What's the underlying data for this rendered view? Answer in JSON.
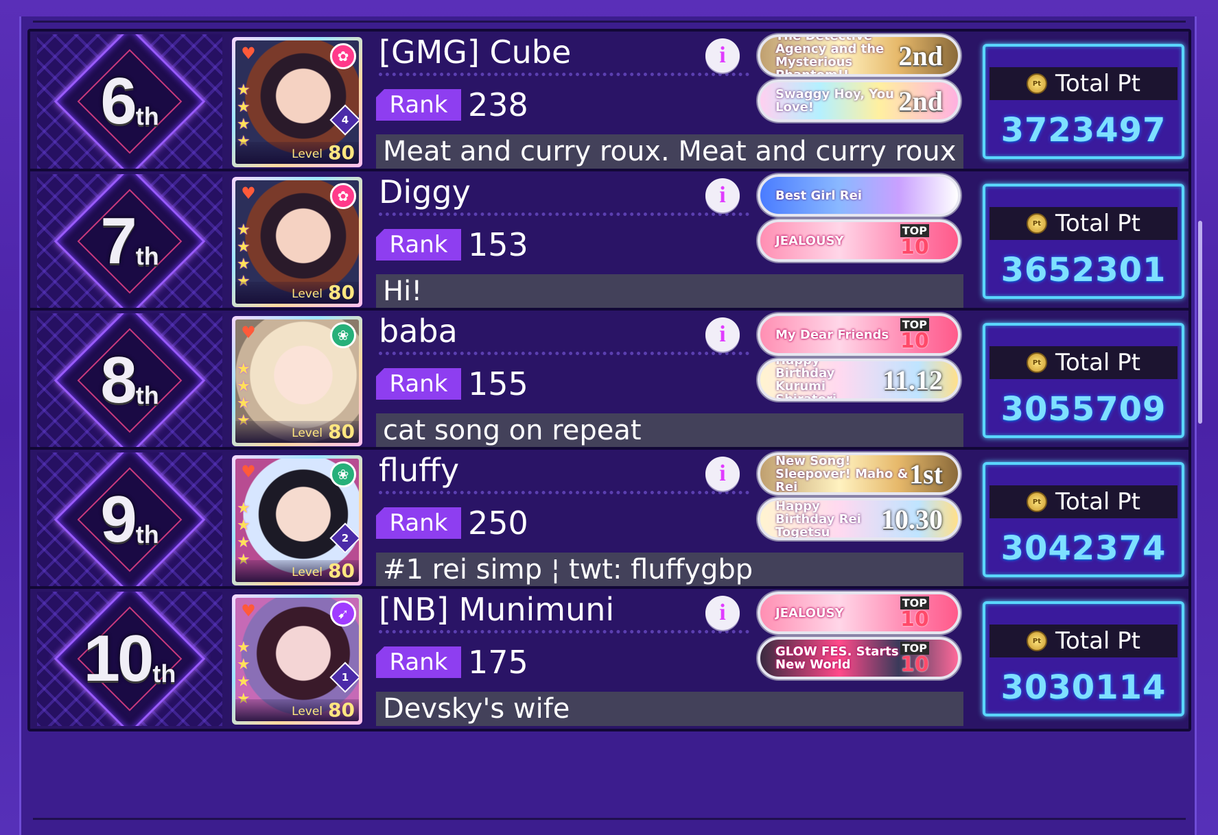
{
  "rows": [
    {
      "place_num": "6",
      "place_suffix": "th",
      "name": "[GMG] Cube",
      "rank_label": "Rank",
      "rank_value": "238",
      "comment": "Meat and curry roux. Meat and curry roux",
      "level_label": "Level",
      "level_value": "80",
      "train_level": "4",
      "titles": [
        {
          "text": "The Detective Agency and the Mysterious Phantom!!",
          "rank": "2nd",
          "style": "gold"
        },
        {
          "text": "Swaggy Hoy, You Love!",
          "rank": "2nd",
          "style": "rainbow"
        }
      ],
      "pts_label": "Total Pt",
      "pts_value": "3723497"
    },
    {
      "place_num": "7",
      "place_suffix": "th",
      "name": "Diggy",
      "rank_label": "Rank",
      "rank_value": "153",
      "comment": "Hi!",
      "level_label": "Level",
      "level_value": "80",
      "train_level": "",
      "titles": [
        {
          "text": "Best Girl Rei",
          "rank": "",
          "style": "blue"
        },
        {
          "text": "JEALOUSY",
          "top_label": "TOP",
          "top_value": "10",
          "style": "pink"
        }
      ],
      "pts_label": "Total Pt",
      "pts_value": "3652301"
    },
    {
      "place_num": "8",
      "place_suffix": "th",
      "name": "baba",
      "rank_label": "Rank",
      "rank_value": "155",
      "comment": "cat song on repeat",
      "level_label": "Level",
      "level_value": "80",
      "train_level": "",
      "titles": [
        {
          "text": "My Dear Friends",
          "top_label": "TOP",
          "top_value": "10",
          "style": "pink"
        },
        {
          "text": "Happy Birthday Kurumi Shiratori",
          "rank": "11.12",
          "style": "birthday"
        }
      ],
      "pts_label": "Total Pt",
      "pts_value": "3055709"
    },
    {
      "place_num": "9",
      "place_suffix": "th",
      "name": "fluffy",
      "rank_label": "Rank",
      "rank_value": "250",
      "comment": "#1 rei simp ¦ twt: fluffygbp",
      "level_label": "Level",
      "level_value": "80",
      "train_level": "2",
      "titles": [
        {
          "text": "New Song! Sleepover! Maho & Rei",
          "rank": "1st",
          "style": "gold"
        },
        {
          "text": "Happy Birthday Rei Togetsu",
          "rank": "10.30",
          "style": "birthday"
        }
      ],
      "pts_label": "Total Pt",
      "pts_value": "3042374"
    },
    {
      "place_num": "10",
      "place_suffix": "th",
      "name": "[NB] Munimuni",
      "rank_label": "Rank",
      "rank_value": "175",
      "comment": "Devsky's wife",
      "level_label": "Level",
      "level_value": "80",
      "train_level": "1",
      "titles": [
        {
          "text": "JEALOUSY",
          "top_label": "TOP",
          "top_value": "10",
          "style": "pink"
        },
        {
          "text": "GLOW FES. Starts New World",
          "top_label": "TOP",
          "top_value": "10",
          "style": "dark"
        }
      ],
      "pts_label": "Total Pt",
      "pts_value": "3030114"
    }
  ],
  "colors": {
    "accent_purple": "#8e3ef0",
    "pts_cyan": "#7ee0ff",
    "background": "#3c1d8e"
  },
  "icons": [
    "band-emblem-icon",
    "attribute-icon",
    "star-icon",
    "info-icon",
    "event-point-coin-icon"
  ]
}
